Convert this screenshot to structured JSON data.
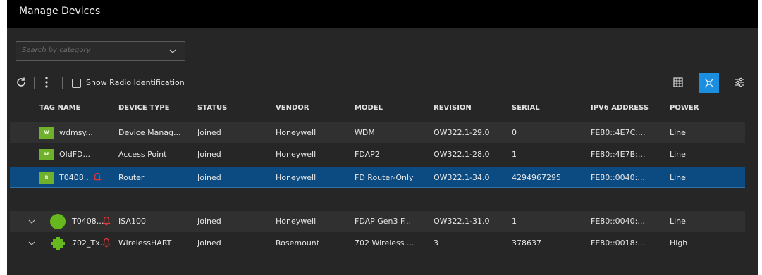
{
  "title": "Manage Devices",
  "search": {
    "placeholder": "Search by category"
  },
  "toolbar": {
    "show_radio_label": "Show Radio Identification"
  },
  "columns": [
    "TAG NAME",
    "DEVICE TYPE",
    "STATUS",
    "VENDOR",
    "MODEL",
    "REVISION",
    "SERIAL",
    "IPV6 ADDRESS",
    "POWER"
  ],
  "rows_top": [
    {
      "badge": "W",
      "tag": "wdmsy...",
      "type": "Device Manag...",
      "status": "Joined",
      "vendor": "Honeywell",
      "model": "WDM",
      "revision": "OW322.1-29.0",
      "serial": "0",
      "ipv6": "FE80::4E7C:...",
      "power": "Line"
    },
    {
      "badge": "AP",
      "tag": "OldFD...",
      "type": "Access Point",
      "status": "Joined",
      "vendor": "Honeywell",
      "model": "FDAP2",
      "revision": "OW322.1-28.0",
      "serial": "1",
      "ipv6": "FE80::4E7B:...",
      "power": "Line"
    },
    {
      "badge": "R",
      "tag": "T0408...",
      "type": "Router",
      "status": "Joined",
      "vendor": "Honeywell",
      "model": "FD Router-Only",
      "revision": "OW322.1-34.0",
      "serial": "4294967295",
      "ipv6": "FE80::0040:...",
      "power": "Line"
    }
  ],
  "rows_bottom": [
    {
      "tag": "T0408...",
      "type": "ISA100",
      "status": "Joined",
      "vendor": "Honeywell",
      "model": "FDAP Gen3 F...",
      "revision": "OW322.1-31.0",
      "serial": "1",
      "ipv6": "FE80::0040:...",
      "power": "Line"
    },
    {
      "tag": "702_Tx...",
      "type": "WirelessHART",
      "status": "Joined",
      "vendor": "Rosemount",
      "model": "702 Wireless ...",
      "revision": "3",
      "serial": "378637",
      "ipv6": "FE80::0018:...",
      "power": "High"
    }
  ],
  "colors": {
    "accent": "#1c8ee0",
    "selected_row": "#0c4b81",
    "badge_green": "#6fb12a",
    "alarm_red": "#e0353b"
  }
}
